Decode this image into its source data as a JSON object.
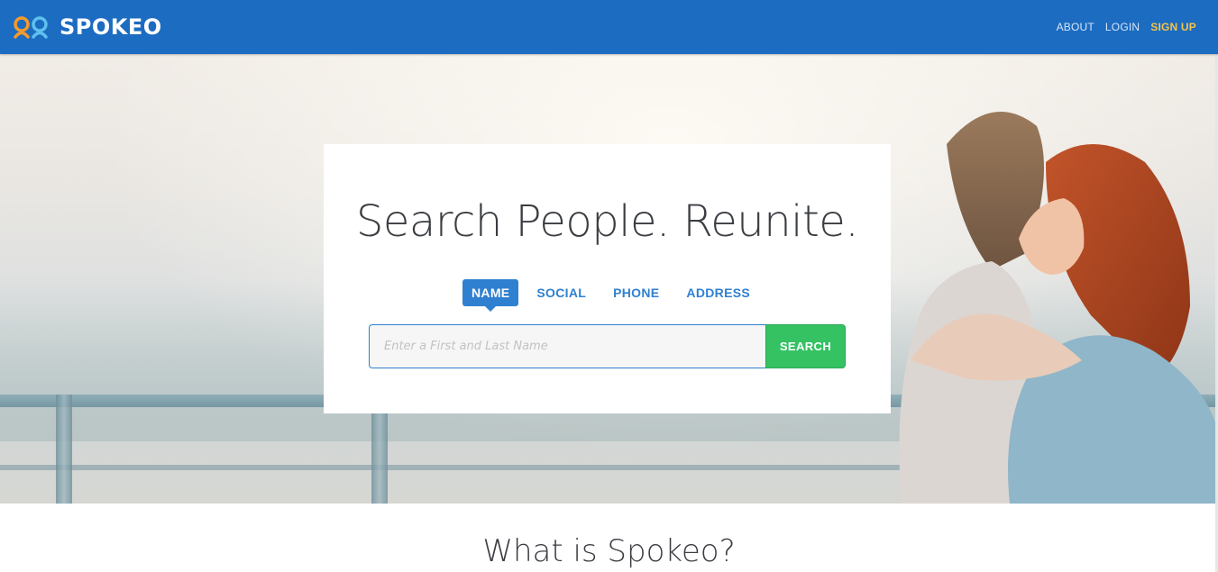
{
  "header": {
    "brand": "SPOKEO",
    "nav": [
      {
        "label": "ABOUT"
      },
      {
        "label": "LOGIN"
      },
      {
        "label": "SIGN UP"
      }
    ]
  },
  "hero": {
    "headline": "Search People. Reunite.",
    "tabs": [
      {
        "label": "NAME",
        "active": true
      },
      {
        "label": "SOCIAL",
        "active": false
      },
      {
        "label": "PHONE",
        "active": false
      },
      {
        "label": "ADDRESS",
        "active": false
      }
    ],
    "search": {
      "placeholder": "Enter a First and Last Name",
      "value": "",
      "button_label": "SEARCH"
    }
  },
  "section": {
    "title": "What is Spokeo?"
  },
  "colors": {
    "header_bg": "#1c6cc1",
    "accent": "#2f80d1",
    "signup": "#f6c34a",
    "search_button": "#34c263"
  }
}
